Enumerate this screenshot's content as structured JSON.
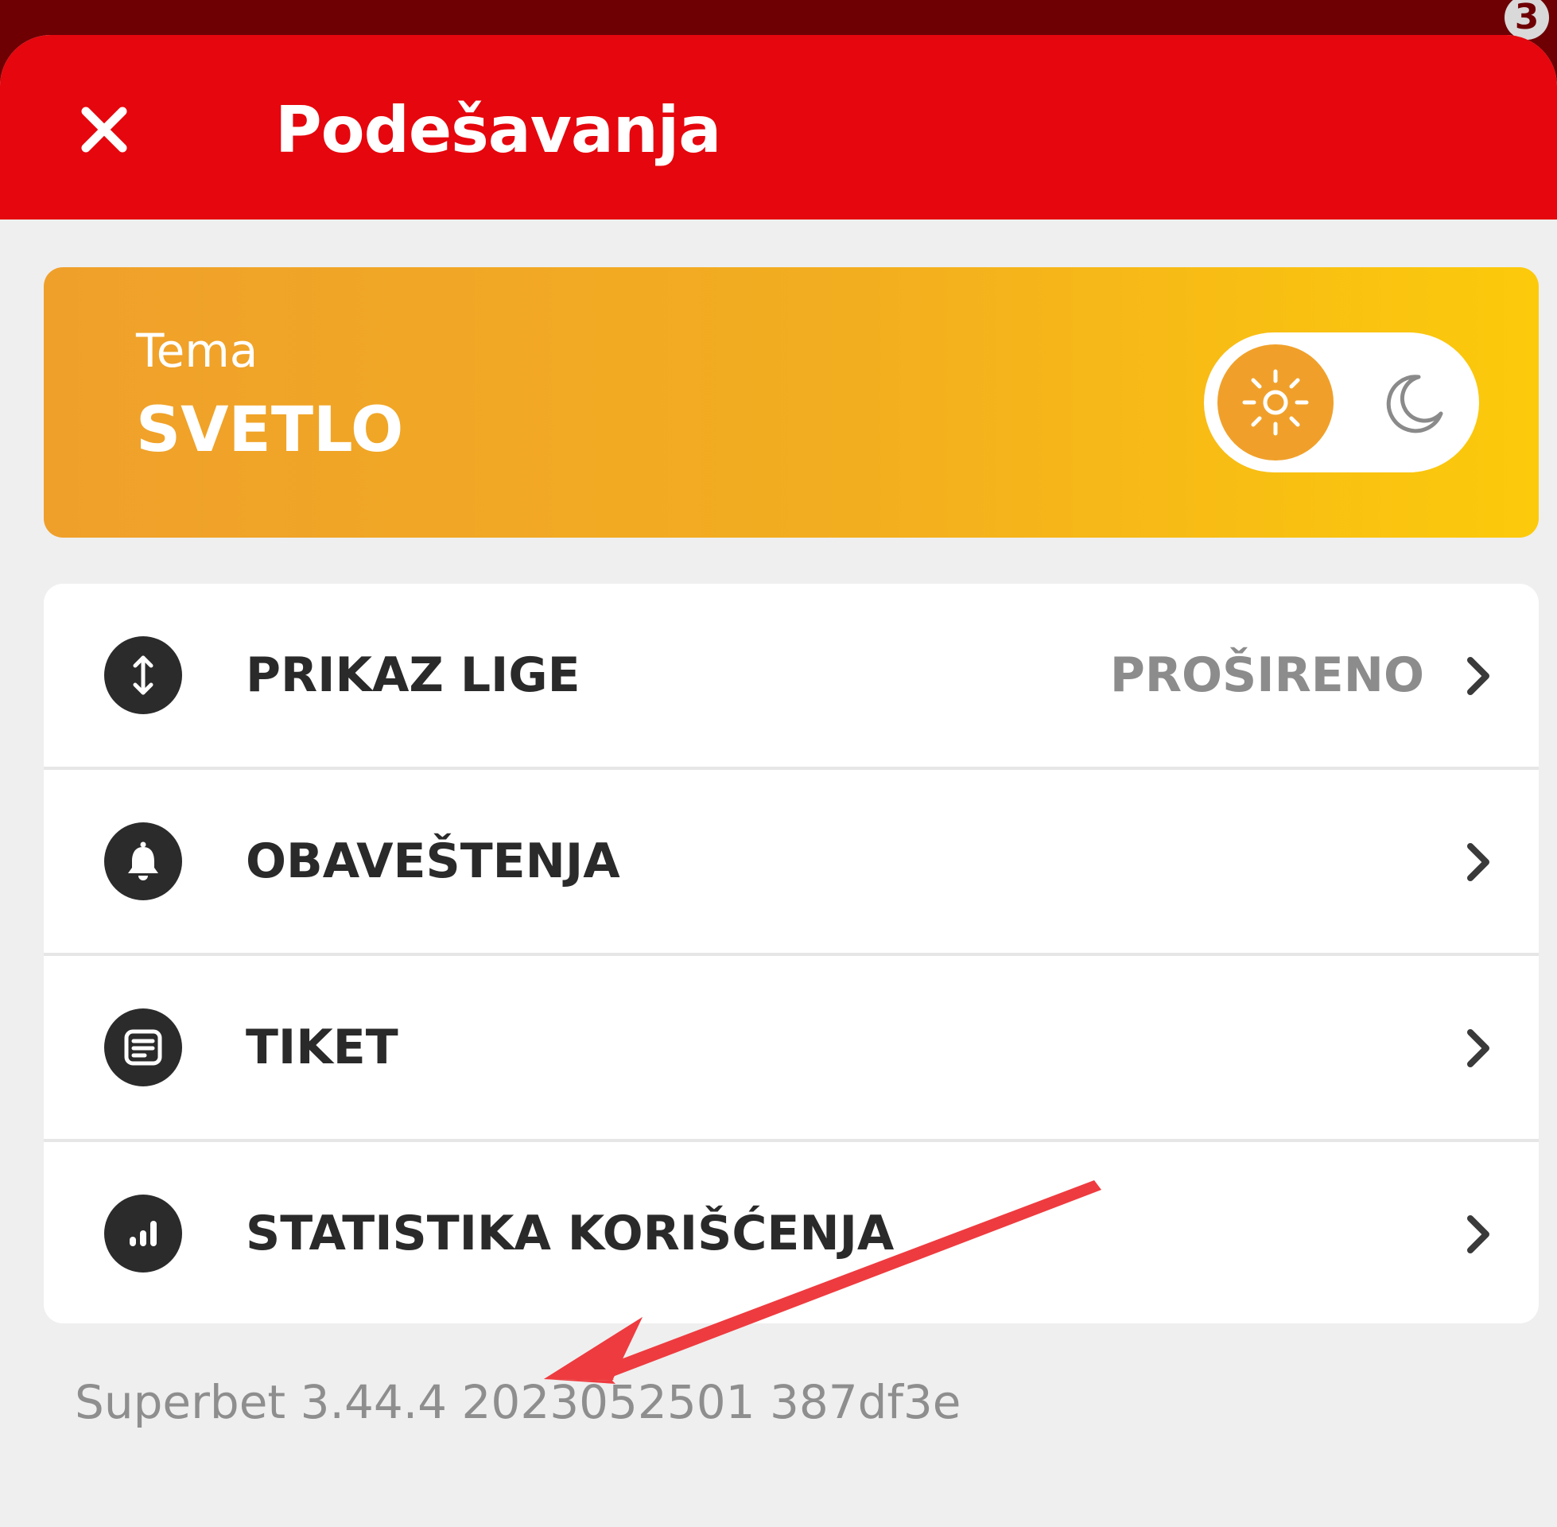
{
  "status": {
    "notification_count": "3"
  },
  "header": {
    "title": "Podešavanja"
  },
  "theme": {
    "label": "Tema",
    "value": "SVETLO",
    "mode": "light"
  },
  "menu": {
    "items": [
      {
        "label": "PRIKAZ LIGE",
        "value": "PROŠIRENO",
        "icon": "sort-arrows-icon"
      },
      {
        "label": "OBAVEŠTENJA",
        "value": "",
        "icon": "bell-icon"
      },
      {
        "label": "TIKET",
        "value": "",
        "icon": "ticket-icon"
      },
      {
        "label": "STATISTIKA KORIŠĆENJA",
        "value": "",
        "icon": "bar-chart-icon"
      }
    ]
  },
  "footer": {
    "version": "Superbet 3.44.4 2023052501 387df3e"
  },
  "colors": {
    "header": "#e6060d",
    "backdrop": "#6e0004",
    "theme_gradient_start": "#efa02b",
    "theme_gradient_end": "#fcca0b",
    "annotation_arrow": "#ee3b3f"
  }
}
